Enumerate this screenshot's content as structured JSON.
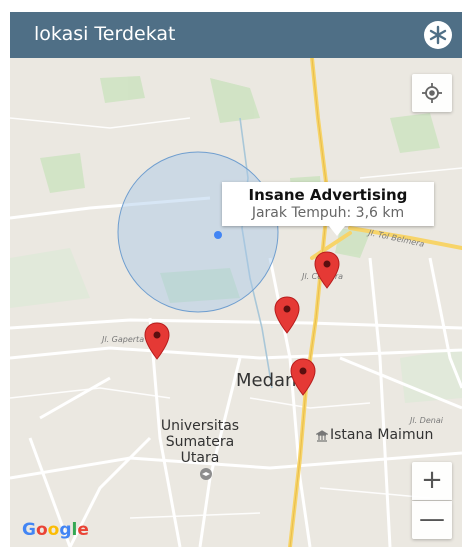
{
  "app_bar": {
    "title": "lokasi Terdekat",
    "action_icon": "asterisk-icon",
    "background": "#4f6f86"
  },
  "map": {
    "info_window": {
      "name": "Insane Advertising",
      "distance": "Jarak Tempuh: 3,6 km"
    },
    "labels": {
      "city": "Medan",
      "university_line1": "Universitas",
      "university_line2": "Sumatera",
      "university_line3": "Utara",
      "palace": "Istana Maimun",
      "road_tol": "Jl. Tol Belmera",
      "road_gaperta": "Jl. Gaperta",
      "road_denai": "Jl. Denai",
      "road_kota": "Jl. Cemara"
    },
    "marker_color": "#e53935",
    "logo": "Google",
    "controls": {
      "my_location_icon": "my-location-icon",
      "zoom_in": "+",
      "zoom_out": "—"
    }
  }
}
